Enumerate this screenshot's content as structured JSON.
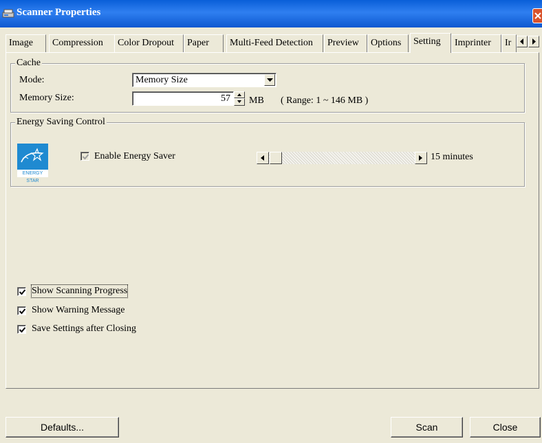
{
  "window": {
    "title": "Scanner Properties",
    "icon": "scanner-icon",
    "close_icon": "close-icon"
  },
  "tabs": [
    {
      "label": "Image",
      "active": false
    },
    {
      "label": "Compression",
      "active": false
    },
    {
      "label": "Color Dropout",
      "active": false
    },
    {
      "label": "Paper",
      "active": false
    },
    {
      "label": "Multi-Feed Detection",
      "active": false
    },
    {
      "label": "Preview",
      "active": false
    },
    {
      "label": "Options",
      "active": false
    },
    {
      "label": "Setting",
      "active": true
    },
    {
      "label": "Imprinter",
      "active": false
    },
    {
      "label": "Ir",
      "active": false
    }
  ],
  "cache": {
    "legend": "Cache",
    "mode_label": "Mode:",
    "mode_value": "Memory Size",
    "memory_label": "Memory Size:",
    "memory_value": "57",
    "memory_unit": "MB",
    "range_text": "( Range: 1 ~ 146 MB )"
  },
  "energy": {
    "legend": "Energy Saving Control",
    "logo_text": "ENERGY STAR",
    "enable_label": "Enable Energy Saver",
    "enable_checked": true,
    "enable_disabled": true,
    "slider_value_fraction": 0.0,
    "minutes_text": "15 minutes"
  },
  "options": [
    {
      "label": "Show Scanning Progress",
      "checked": true
    },
    {
      "label": "Show Warning Message",
      "checked": true
    },
    {
      "label": "Save Settings after Closing",
      "checked": true
    }
  ],
  "buttons": {
    "defaults": "Defaults...",
    "scan": "Scan",
    "close": "Close"
  },
  "colors": {
    "titlebar": "#0a5fd8",
    "dialog_bg": "#ece9d8",
    "energy_star_blue": "#1f8ad1"
  }
}
